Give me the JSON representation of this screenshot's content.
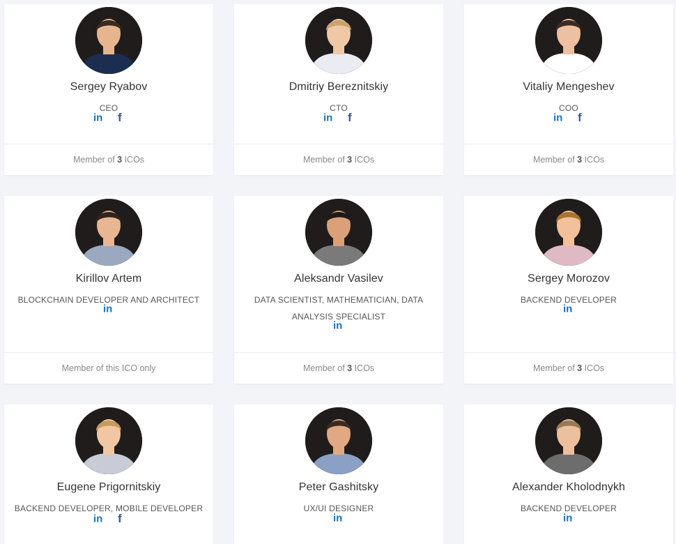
{
  "colors": {
    "background": "#f3f4f8",
    "card": "#ffffff",
    "icon_blue": "#1a73b8",
    "icon_facebook": "#3b5a8f"
  },
  "team": [
    {
      "name": "Sergey Ryabov",
      "role": "CEO",
      "socials": [
        "linkedin-icon",
        "facebook-icon"
      ],
      "footer": {
        "prefix": "Member of ",
        "count": "3",
        "suffix": " ICOs"
      }
    },
    {
      "name": "Dmitriy Bereznitskiy",
      "role": "CTO",
      "socials": [
        "linkedin-icon",
        "facebook-icon"
      ],
      "footer": {
        "prefix": "Member of ",
        "count": "3",
        "suffix": " ICOs"
      }
    },
    {
      "name": "Vitaliy Mengeshev",
      "role": "COO",
      "socials": [
        "linkedin-icon",
        "facebook-icon"
      ],
      "footer": {
        "prefix": "Member of ",
        "count": "3",
        "suffix": " ICOs"
      }
    },
    {
      "name": "Kirillov Artem",
      "role": "BLOCKCHAIN DEVELOPER AND ARCHITECT",
      "socials": [
        "linkedin-icon"
      ],
      "footer": {
        "prefix": "Member of this ICO only",
        "count": "",
        "suffix": ""
      }
    },
    {
      "name": "Aleksandr Vasilev",
      "role": "DATA SCIENTIST, MATHEMATICIAN, DATA ANALYSIS SPECIALIST",
      "socials": [
        "linkedin-icon"
      ],
      "footer": {
        "prefix": "Member of ",
        "count": "3",
        "suffix": " ICOs"
      }
    },
    {
      "name": "Sergey Morozov",
      "role": "BACKEND DEVELOPER",
      "socials": [
        "linkedin-icon"
      ],
      "footer": {
        "prefix": "Member of ",
        "count": "3",
        "suffix": " ICOs"
      }
    },
    {
      "name": "Eugene Prigornitskiy",
      "role": "BACKEND DEVELOPER, MOBILE DEVELOPER",
      "socials": [
        "linkedin-icon",
        "facebook-icon"
      ],
      "footer": {
        "prefix": "",
        "count": "",
        "suffix": ""
      }
    },
    {
      "name": "Peter Gashitsky",
      "role": "UX/UI DESIGNER",
      "socials": [
        "linkedin-icon"
      ],
      "footer": {
        "prefix": "",
        "count": "",
        "suffix": ""
      }
    },
    {
      "name": "Alexander Kholodnykh",
      "role": "BACKEND DEVELOPER",
      "socials": [
        "linkedin-icon"
      ],
      "footer": {
        "prefix": "",
        "count": "",
        "suffix": ""
      }
    }
  ]
}
